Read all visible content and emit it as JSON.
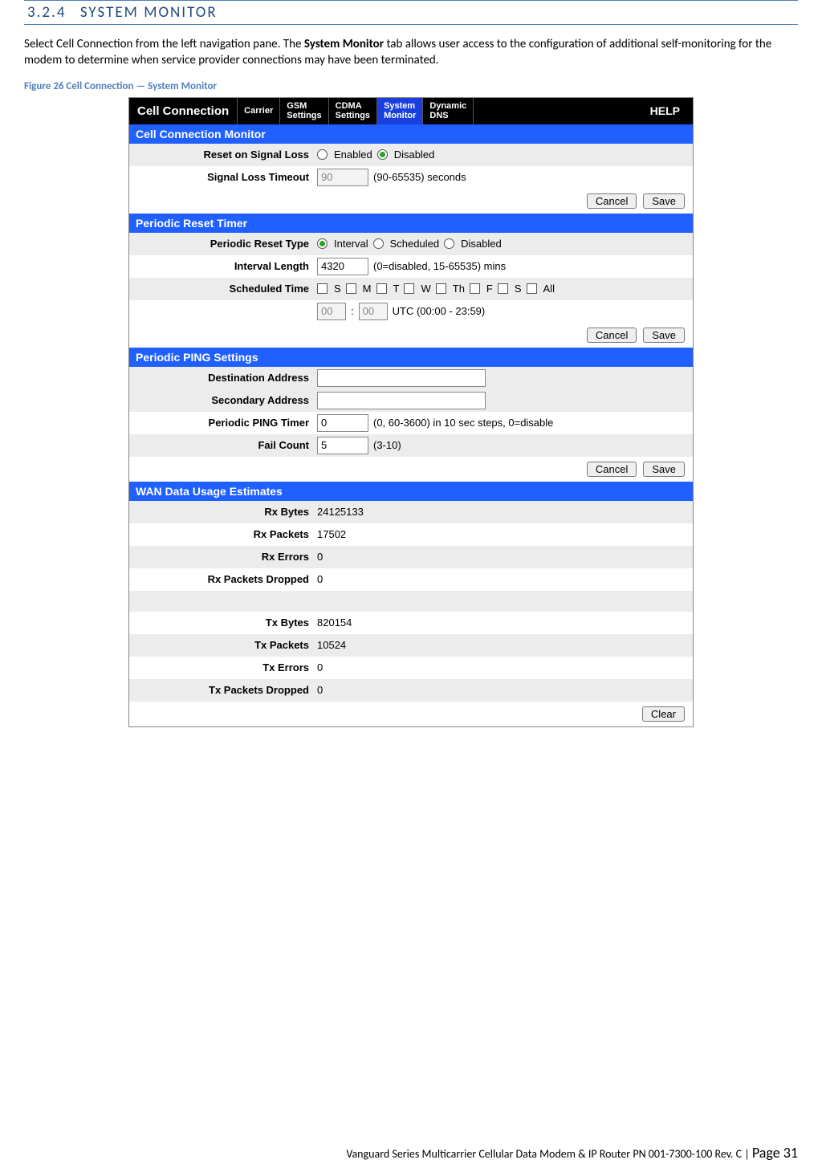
{
  "heading": {
    "num": "3.2.4",
    "title": "SYSTEM MONITOR"
  },
  "intro": {
    "p1a": "Select Cell Connection from the left navigation pane. The ",
    "bold": "System Monitor",
    "p1b": " tab allows user access to the configuration of additional self-monitoring for the modem to determine when service provider connections may have been terminated."
  },
  "figcaption": "Figure 26 Cell Connection — System Monitor",
  "tabs": {
    "main": "Cell Connection",
    "t0": "Carrier",
    "t1a": "GSM",
    "t1b": "Settings",
    "t2a": "CDMA",
    "t2b": "Settings",
    "t3a": "System",
    "t3b": "Monitor",
    "t4a": "Dynamic",
    "t4b": "DNS",
    "help": "HELP"
  },
  "sec1": {
    "head": "Cell Connection Monitor",
    "r1l": "Reset on Signal Loss",
    "r1o1": "Enabled",
    "r1o2": "Disabled",
    "r2l": "Signal Loss Timeout",
    "r2v": "90",
    "r2h": "(90-65535) seconds",
    "cancel": "Cancel",
    "save": "Save"
  },
  "sec2": {
    "head": "Periodic Reset Timer",
    "r1l": "Periodic Reset Type",
    "r1o1": "Interval",
    "r1o2": "Scheduled",
    "r1o3": "Disabled",
    "r2l": "Interval Length",
    "r2v": "4320",
    "r2h": "(0=disabled, 15-65535) mins",
    "r3l": "Scheduled Time",
    "days": {
      "d0": "S",
      "d1": "M",
      "d2": "T",
      "d3": "W",
      "d4": "Th",
      "d5": "F",
      "d6": "S",
      "d7": "All"
    },
    "hh": "00",
    "mm": "00",
    "tzh": "UTC (00:00 - 23:59)",
    "cancel": "Cancel",
    "save": "Save"
  },
  "sec3": {
    "head": "Periodic PING Settings",
    "r1l": "Destination Address",
    "r1v": "",
    "r2l": "Secondary Address",
    "r2v": "",
    "r3l": "Periodic PING Timer",
    "r3v": "0",
    "r3h": "(0, 60-3600) in 10 sec steps, 0=disable",
    "r4l": "Fail Count",
    "r4v": "5",
    "r4h": "(3-10)",
    "cancel": "Cancel",
    "save": "Save"
  },
  "sec4": {
    "head": "WAN Data Usage Estimates",
    "r1l": "Rx Bytes",
    "r1v": "24125133",
    "r2l": "Rx Packets",
    "r2v": "17502",
    "r3l": "Rx Errors",
    "r3v": "0",
    "r4l": "Rx Packets Dropped",
    "r4v": "0",
    "r5l": "Tx Bytes",
    "r5v": "820154",
    "r6l": "Tx Packets",
    "r6v": "10524",
    "r7l": "Tx Errors",
    "r7v": "0",
    "r8l": "Tx Packets Dropped",
    "r8v": "0",
    "clear": "Clear"
  },
  "footer": {
    "text": "Vanguard Series Multicarrier Cellular Data Modem & IP Router PN 001-7300-100 Rev. C",
    "sep": " | ",
    "page": "Page 31"
  }
}
